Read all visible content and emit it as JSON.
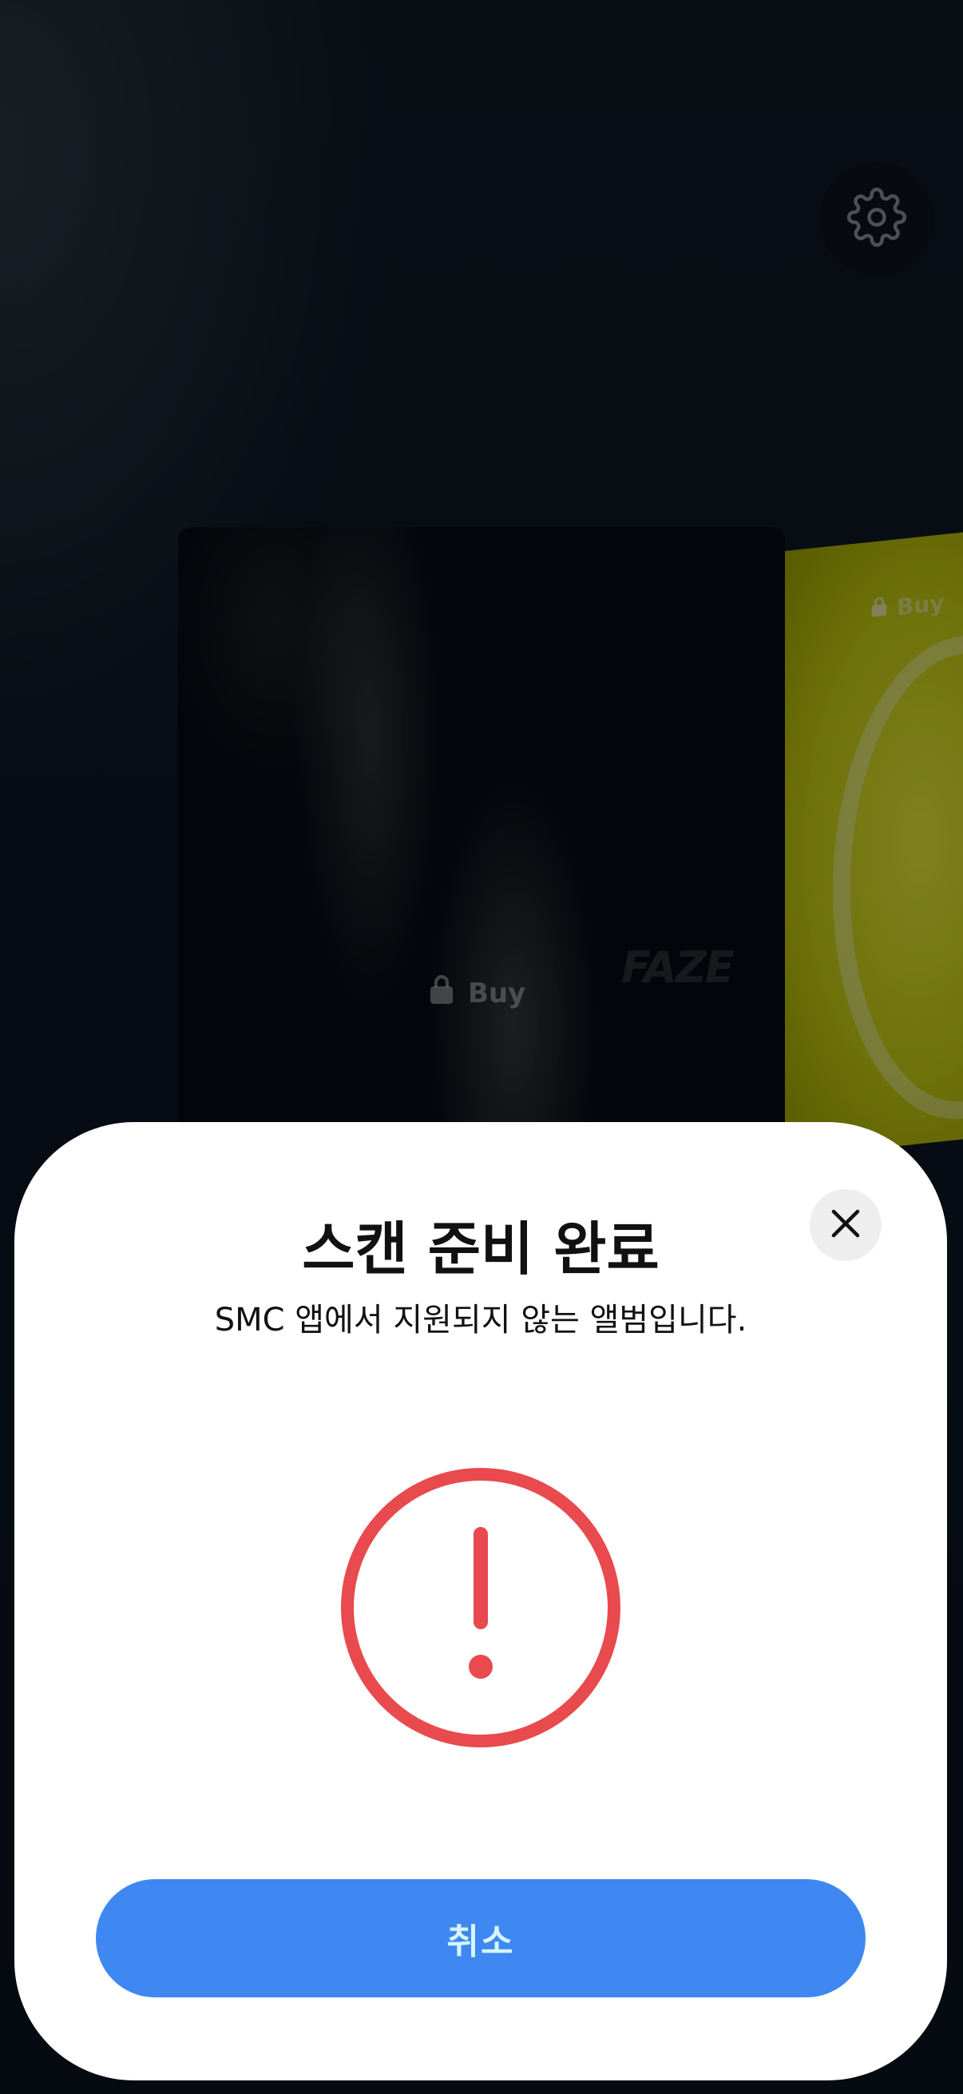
{
  "background": {
    "albums": [
      {
        "buy_label": "Buy",
        "logo_text": "FAZE"
      },
      {
        "buy_label": "Buy"
      }
    ],
    "settings_icon": "gear-icon"
  },
  "sheet": {
    "title": "스캔 준비 완료",
    "subtitle": "SMC 앱에서 지원되지 않는 앨범입니다.",
    "close_icon": "close-icon",
    "status_icon": "exclamation-circle-icon",
    "cancel_label": "취소"
  },
  "colors": {
    "accent": "#3f88f2",
    "error": "#e84a4d",
    "button_text": "#d5f6ff"
  }
}
